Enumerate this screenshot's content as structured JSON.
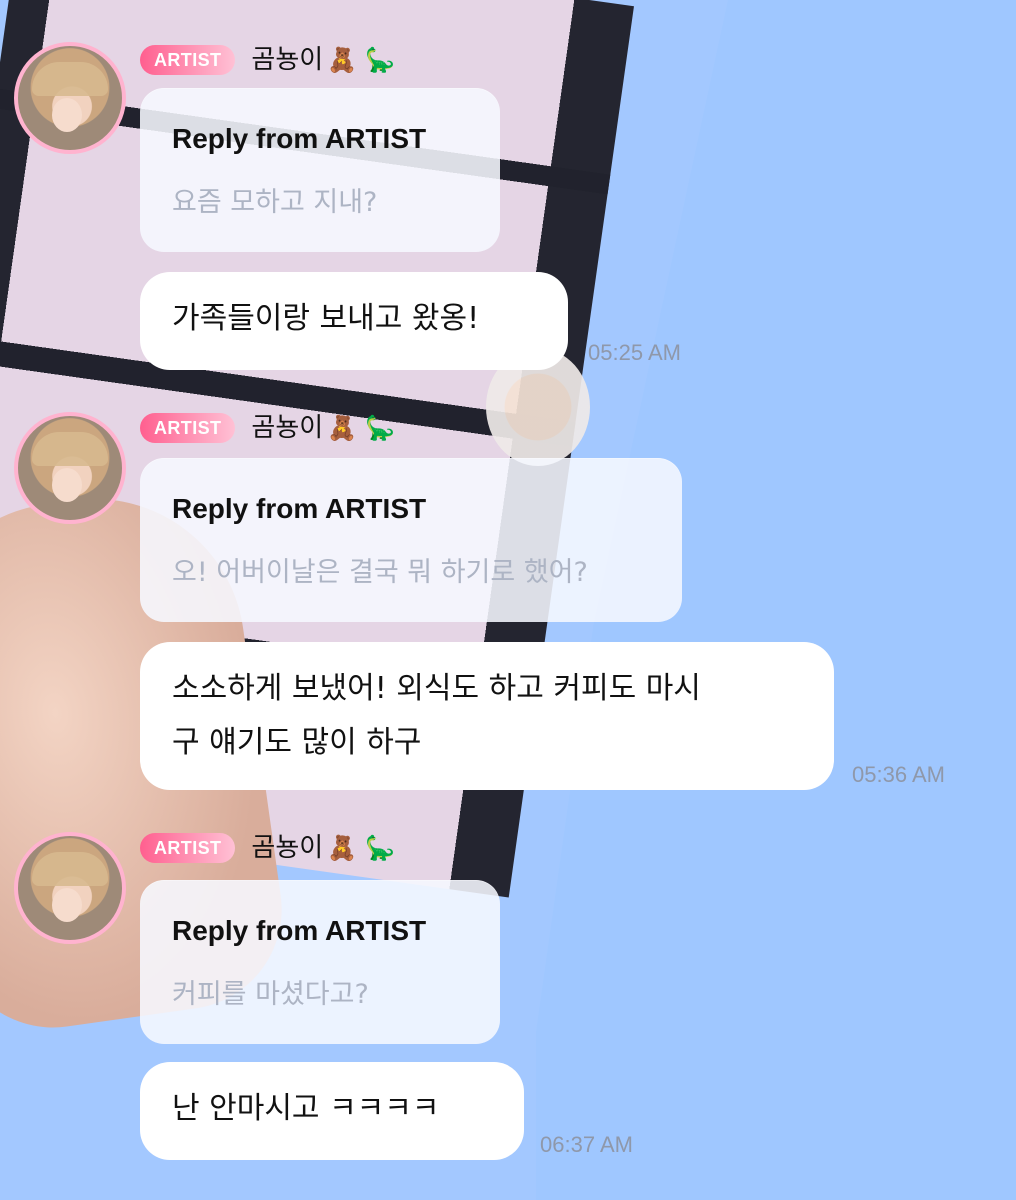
{
  "palette": {
    "background": "#a3c8ff",
    "badge_start": "#ff5f8f",
    "badge_end": "#ffc1d5",
    "reply_background": "#f6f8ff",
    "message_background": "#ffffff",
    "meta_text": "#8f98aa"
  },
  "messages": [
    {
      "badge": "ARTIST",
      "name": "곰뇽이",
      "emoji_bear": "🧸",
      "emoji_dino": "🦕",
      "reply_title": "Reply from ARTIST",
      "reply_text": "요즘 모하고 지내?",
      "body": "가족들이랑 보내고 왔옹!",
      "time": "05:25 AM"
    },
    {
      "badge": "ARTIST",
      "name": "곰뇽이",
      "emoji_bear": "🧸",
      "emoji_dino": "🦕",
      "reply_title": "Reply from ARTIST",
      "reply_text": "오! 어버이날은 결국 뭐 하기로 했어?",
      "body": "소소하게 보냈어! 외식도 하고 커피도 마시\n구 얘기도 많이 하구",
      "time": "05:36 AM"
    },
    {
      "badge": "ARTIST",
      "name": "곰뇽이",
      "emoji_bear": "🧸",
      "emoji_dino": "🦕",
      "reply_title": "Reply from ARTIST",
      "reply_text": "커피를 마셨다고?",
      "body": "난 안마시고 ㅋㅋㅋㅋ",
      "time": "06:37 AM"
    }
  ]
}
